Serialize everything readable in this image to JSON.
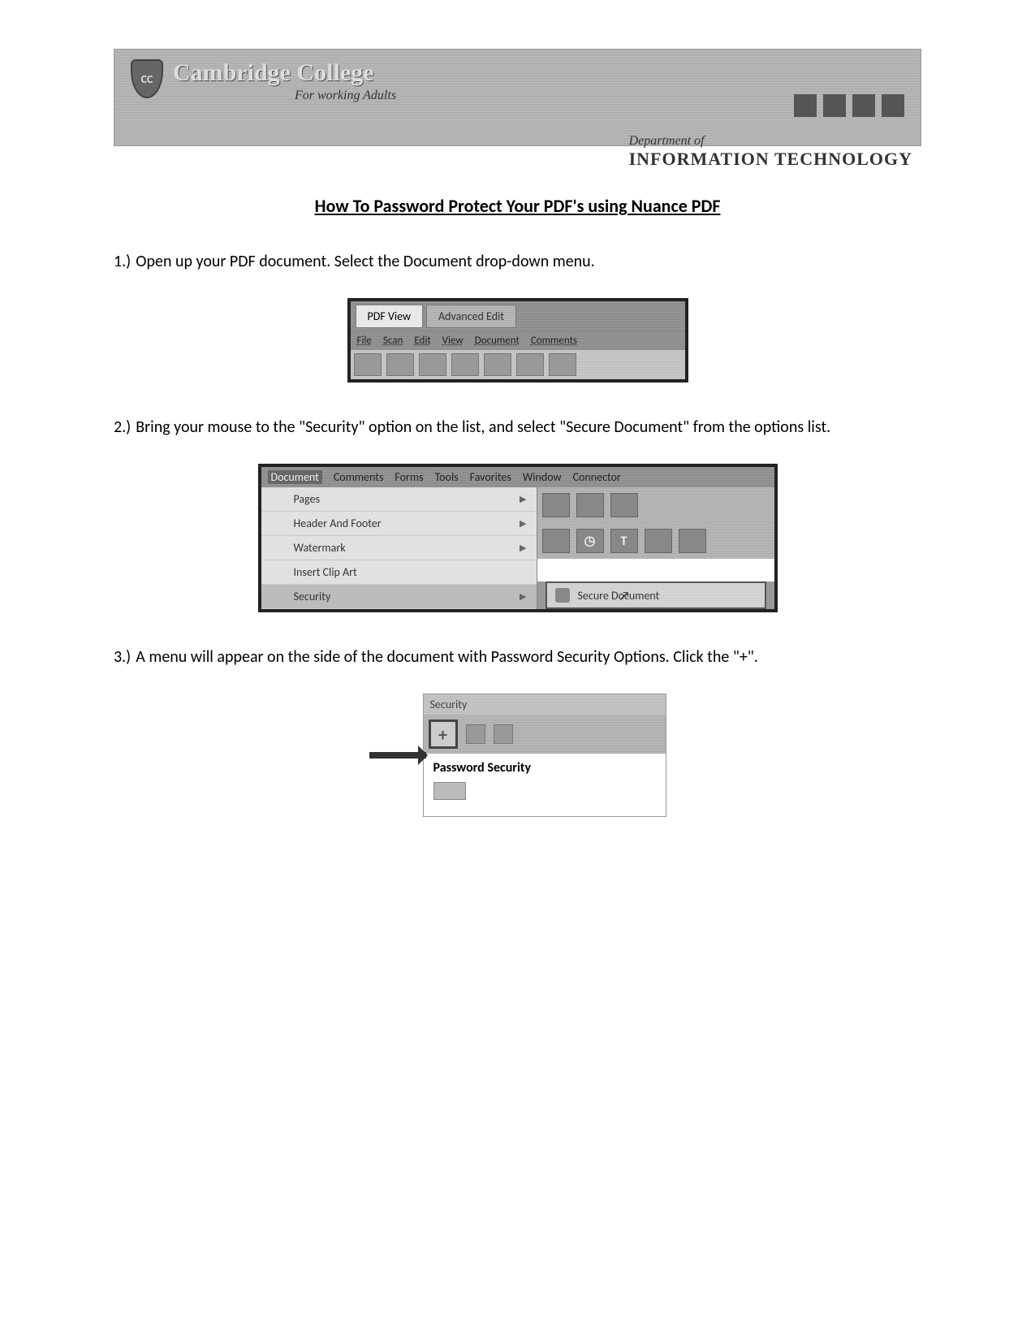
{
  "header": {
    "shield_text": "CC",
    "college_name": "Cambridge College",
    "tagline": "For working Adults",
    "dept_prefix": "Department of",
    "dept_name": "INFORMATION TECHNOLOGY"
  },
  "doc_title": "How To Password Protect Your PDF's using Nuance PDF",
  "steps": [
    {
      "num": "1.)",
      "text": "Open up your PDF document. Select the Document drop-down menu."
    },
    {
      "num": "2.)",
      "text": "Bring your mouse to the \"Security\" option on the list, and select \"Secure Document\" from the options list."
    },
    {
      "num": "3.)",
      "text": "A menu will appear on the side of the document with Password Security Options. Click the \"+\"."
    }
  ],
  "shot1": {
    "tabs": {
      "active": "PDF View",
      "other": "Advanced Edit"
    },
    "menus": [
      "File",
      "Scan",
      "Edit",
      "View",
      "Document",
      "Comments"
    ]
  },
  "shot2": {
    "menus": [
      "Document",
      "Comments",
      "Forms",
      "Tools",
      "Favorites",
      "Window",
      "Connector"
    ],
    "items": [
      {
        "label": "Pages",
        "arrow": true
      },
      {
        "label": "Header And Footer",
        "arrow": true
      },
      {
        "label": "Watermark",
        "arrow": true
      },
      {
        "label": "Insert Clip Art",
        "arrow": false
      },
      {
        "label": "Security",
        "arrow": true,
        "hl": true
      }
    ],
    "flyout": "Secure Document",
    "tool_letters": [
      "",
      "",
      "T",
      "",
      ""
    ]
  },
  "shot3": {
    "panel_title": "Security",
    "plus": "+",
    "section": "Password Security"
  }
}
